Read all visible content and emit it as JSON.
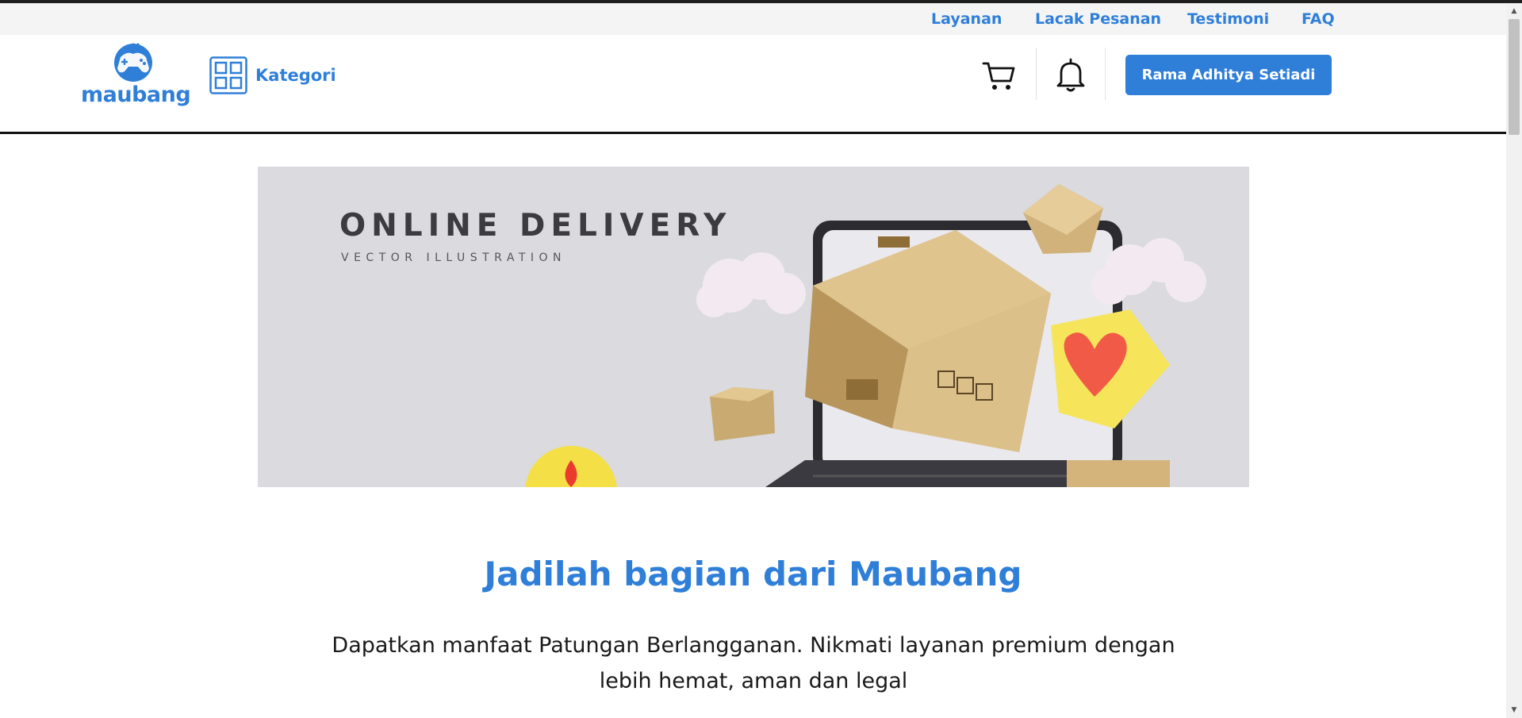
{
  "topbar": {
    "links": [
      "Layanan",
      "Lacak Pesanan",
      "Testimoni",
      "FAQ"
    ]
  },
  "header": {
    "logo_text": "maubang",
    "category_label": "Kategori",
    "cart_icon": "cart-icon",
    "notification_icon": "bell-icon",
    "user_button": "Rama Adhitya Setiadi"
  },
  "banner": {
    "title": "ONLINE DELIVERY",
    "subtitle": "VECTOR ILLUSTRATION"
  },
  "section": {
    "title": "Jadilah bagian dari Maubang",
    "description": "Dapatkan manfaat Patungan Berlangganan. Nikmati layanan premium dengan lebih hemat, aman dan legal"
  },
  "colors": {
    "brand": "#2f7fd9",
    "banner_bg": "#dadadf",
    "topbar_bg": "#f4f4f5"
  }
}
